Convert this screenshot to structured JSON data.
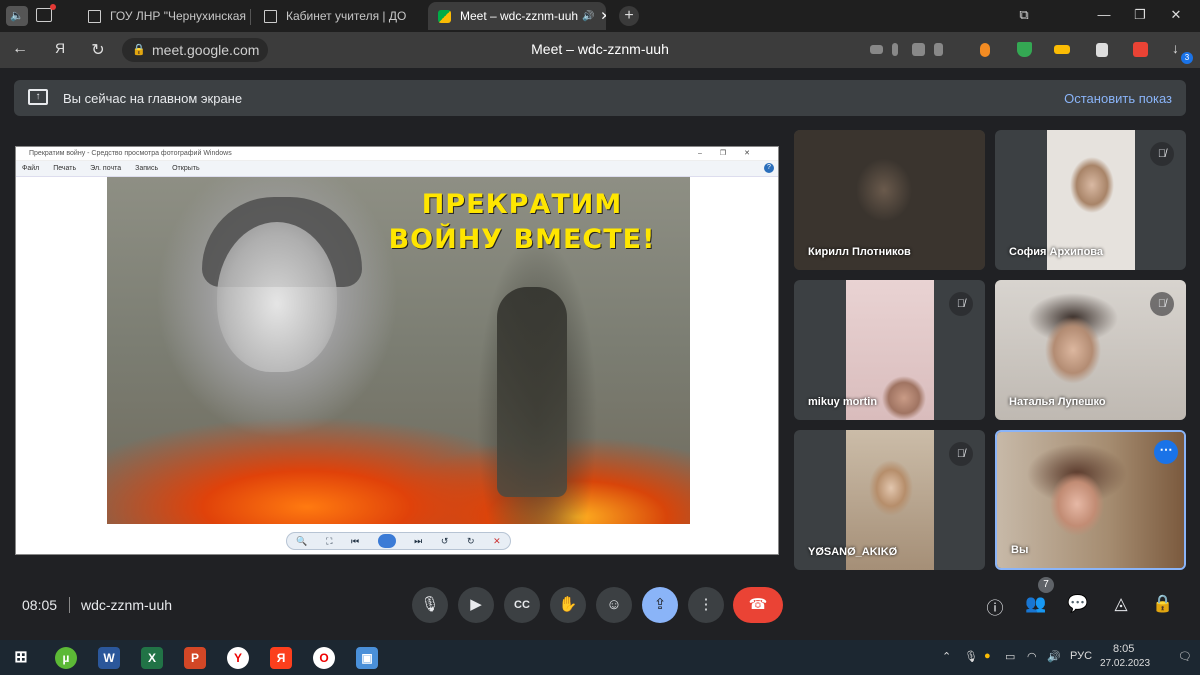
{
  "browser": {
    "tabs": [
      {
        "label": "ГОУ ЛНР \"Чернухинская с"
      },
      {
        "label": "Кабинет учителя | ДО"
      },
      {
        "label": "Meet – wdc-zznm-uuh"
      }
    ],
    "url": "meet.google.com",
    "page_title": "Meet – wdc-zznm-uuh",
    "download_badge": "3"
  },
  "banner": {
    "text": "Вы сейчас на главном экране",
    "stop_label": "Остановить показ"
  },
  "shared_window": {
    "title": "Прекратим войну - Средство просмотра фотографий Windows",
    "menu": [
      "Файл",
      "Печать",
      "Эл. почта",
      "Запись",
      "Открыть"
    ],
    "poster_text_line1": "ПРЕКРАТИМ",
    "poster_text_line2": "ВОЙНУ ВМЕСТЕ!"
  },
  "participants": [
    {
      "name": "Кирилл Плотников",
      "muted": false
    },
    {
      "name": "София Архипова",
      "muted": true
    },
    {
      "name": "mikuy mortin",
      "muted": true
    },
    {
      "name": "Наталья Лупешко",
      "muted": true
    },
    {
      "name": "YØSANØ_AKIKØ",
      "muted": true
    },
    {
      "name": "Вы",
      "muted": false
    }
  ],
  "meeting": {
    "time": "08:05",
    "code": "wdc-zznm-uuh",
    "people_count": "7"
  },
  "taskbar": {
    "lang": "РУС",
    "time": "8:05",
    "date": "27.02.2023"
  },
  "colors": {
    "accent": "#8ab4f8",
    "end_call": "#ea4335",
    "poster_text": "#ffe600"
  }
}
